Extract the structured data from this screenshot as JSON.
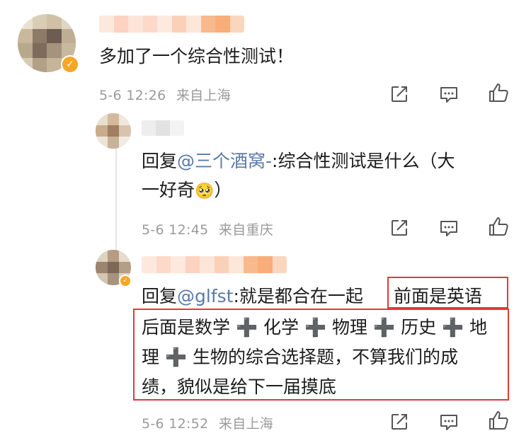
{
  "comments": [
    {
      "text": "多加了一个综合性测试！",
      "time": "5-6 12:26",
      "location": "来自上海"
    }
  ],
  "replies": [
    {
      "reply_prefix": "回复",
      "mention": "@三个酒窝-",
      "text_line1": ":综合性测试是什么（大",
      "text_line2": "一好奇",
      "emoji": "🥺",
      "text_line2_end": "）",
      "time": "5-6 12:45",
      "location": "来自重庆"
    },
    {
      "reply_prefix": "回复",
      "mention": "@glfst",
      "text_line1": ":就是都合在一起",
      "highlight1": "前面是英语",
      "line2": "后面是数学 ➕ 化学 ➕ 物理 ➕ 历史 ➕ 地",
      "line3": "理 ➕ 生物的综合选择题，不算我们的成",
      "line4": "绩，貌似是给下一届摸底",
      "time": "5-6 12:52",
      "location": "来自上海"
    }
  ],
  "icons": {
    "share": "share-icon",
    "comment": "comment-icon",
    "like": "thumbs-up-icon",
    "verified": "verified-badge-icon"
  },
  "colors": {
    "mention": "#5b7aa8",
    "meta": "#9a9a9a",
    "highlight_border": "#e53935",
    "badge": "#f5a623"
  }
}
